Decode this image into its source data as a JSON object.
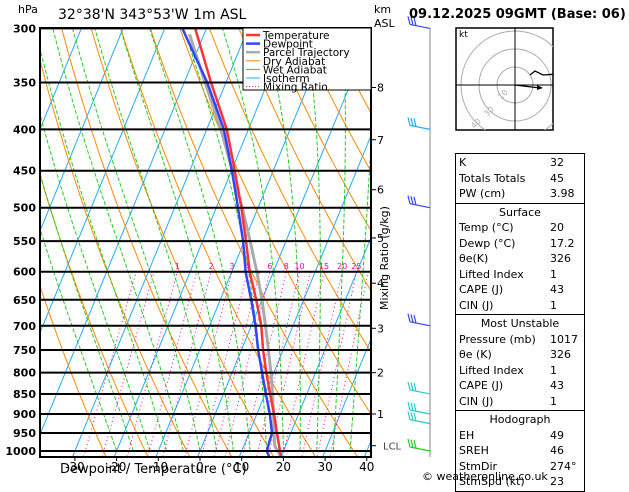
{
  "header": {
    "hpa": "hPa",
    "location": "32°38'N  343°53'W  1m  ASL",
    "km": "km",
    "asl": "ASL",
    "datetime": "09.12.2025  09GMT  (Base: 06)"
  },
  "copyright": "© weatheronline.co.uk",
  "colors": {
    "temperature": "#ff3333",
    "dewpoint": "#3344ff",
    "parcel": "#aaaaaa",
    "dry_adiabat": "#ff8800",
    "wet_adiabat": "#22cc22",
    "isotherm": "#22aaff",
    "mixing_ratio": "#ff00aa"
  },
  "chart_data": {
    "type": "line",
    "subtype": "skew-T log-P",
    "xlabel": "Dewpoint / Temperature (°C)",
    "ylabel": "hPa",
    "y2label": "Mixing Ratio (g/kg)",
    "x_ticks": [
      -30,
      -20,
      -10,
      0,
      10,
      20,
      30,
      40
    ],
    "p_ticks": [
      300,
      350,
      400,
      450,
      500,
      550,
      600,
      650,
      700,
      750,
      800,
      850,
      900,
      950,
      1000
    ],
    "xlim": [
      -38,
      41
    ],
    "plim": [
      300,
      1017
    ],
    "y_scale": "log",
    "km_ticks": [
      {
        "km": 1,
        "p": 900
      },
      {
        "km": 2,
        "p": 800
      },
      {
        "km": 3,
        "p": 705
      },
      {
        "km": 4,
        "p": 620
      },
      {
        "km": 5,
        "p": 545
      },
      {
        "km": 6,
        "p": 475
      },
      {
        "km": 7,
        "p": 412
      },
      {
        "km": 8,
        "p": 355
      }
    ],
    "lcl_label": "LCL",
    "lcl_p": 985,
    "mixing_ratio_labels": [
      1,
      2,
      3,
      4,
      6,
      8,
      10,
      15,
      20,
      25
    ],
    "legend": [
      "Temperature",
      "Dewpoint",
      "Parcel Trajectory",
      "Dry Adiabat",
      "Wet Adiabat",
      "Isotherm",
      "Mixing Ratio"
    ],
    "legend_position": "top-right",
    "series": [
      {
        "name": "Temperature",
        "p": [
          1017,
          950,
          900,
          850,
          800,
          750,
          700,
          650,
          600,
          550,
          500,
          450,
          400,
          350,
          300
        ],
        "t": [
          20,
          16.7,
          14.1,
          11.2,
          8.2,
          5.2,
          2.4,
          -1.4,
          -5.7,
          -9.6,
          -14,
          -19.2,
          -25.2,
          -33.6,
          -42.7
        ]
      },
      {
        "name": "Dewpoint",
        "p": [
          1017,
          1000,
          950,
          900,
          850,
          800,
          750,
          700,
          650,
          600,
          550,
          500,
          450,
          400,
          350,
          300
        ],
        "t": [
          17.2,
          16,
          15.5,
          13.1,
          10.2,
          7.2,
          4,
          1,
          -2.6,
          -6.7,
          -10.3,
          -14.8,
          -19.9,
          -25.9,
          -34.5,
          -45.8
        ]
      },
      {
        "name": "Parcel Trajectory",
        "p": [
          1017,
          985,
          950,
          900,
          850,
          800,
          750,
          700,
          650,
          600,
          550,
          500,
          450,
          400,
          350,
          305
        ],
        "t": [
          20,
          17.4,
          16,
          14,
          11.8,
          9.3,
          6.5,
          3.4,
          0,
          -4,
          -8.6,
          -13.8,
          -19.8,
          -26.6,
          -35,
          -43.5
        ]
      }
    ],
    "winds": [
      {
        "p": 300,
        "color": "#3344ff"
      },
      {
        "p": 400,
        "color": "#22aaff"
      },
      {
        "p": 500,
        "color": "#3344ff"
      },
      {
        "p": 700,
        "color": "#3344ff"
      },
      {
        "p": 850,
        "color": "#22cccc"
      },
      {
        "p": 900,
        "color": "#22cccc"
      },
      {
        "p": 925,
        "color": "#22cccc"
      },
      {
        "p": 1000,
        "color": "#22cc22"
      }
    ]
  },
  "hodograph": {
    "unit": "kt",
    "rings": [
      "10",
      "30",
      "40"
    ]
  },
  "indices": {
    "rows": [
      {
        "k": "K",
        "v": "32"
      },
      {
        "k": "Totals Totals",
        "v": "45"
      },
      {
        "k": "PW (cm)",
        "v": "3.98"
      }
    ],
    "surface": {
      "title": "Surface",
      "rows": [
        {
          "k": "Temp (°C)",
          "v": "20"
        },
        {
          "k": "Dewp (°C)",
          "v": "17.2"
        },
        {
          "k": "θe(K)",
          "v": "326"
        },
        {
          "k": "Lifted Index",
          "v": "1"
        },
        {
          "k": "CAPE (J)",
          "v": "43"
        },
        {
          "k": "CIN (J)",
          "v": "1"
        }
      ]
    },
    "most_unstable": {
      "title": "Most Unstable",
      "rows": [
        {
          "k": "Pressure (mb)",
          "v": "1017"
        },
        {
          "k": "θe (K)",
          "v": "326"
        },
        {
          "k": "Lifted Index",
          "v": "1"
        },
        {
          "k": "CAPE (J)",
          "v": "43"
        },
        {
          "k": "CIN (J)",
          "v": "1"
        }
      ]
    },
    "hodograph": {
      "title": "Hodograph",
      "rows": [
        {
          "k": "EH",
          "v": "49"
        },
        {
          "k": "SREH",
          "v": "46"
        },
        {
          "k": "StmDir",
          "v": "274°"
        },
        {
          "k": "StmSpd (kt)",
          "v": "23"
        }
      ]
    }
  }
}
